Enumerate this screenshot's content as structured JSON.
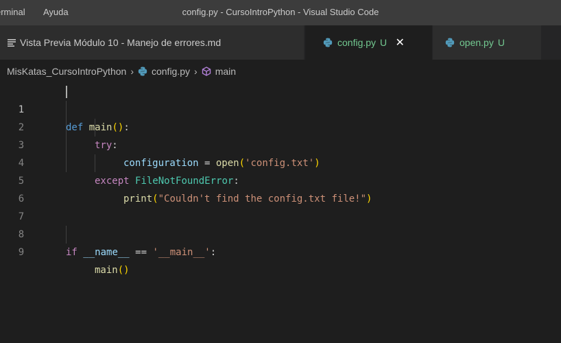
{
  "titlebar": {
    "menu": [
      "erminal",
      "Ayuda"
    ],
    "title": "config.py - CursoIntroPython - Visual Studio Code"
  },
  "tabs": [
    {
      "label": "Vista Previa Módulo 10 - Manejo de errores.md",
      "icon": "preview-icon",
      "status": "",
      "active": false
    },
    {
      "label": "config.py",
      "icon": "python-icon",
      "status": "U",
      "active": true,
      "close": "✕"
    },
    {
      "label": "open.py",
      "icon": "python-icon",
      "status": "U",
      "active": false
    }
  ],
  "breadcrumb": {
    "folder": "MisKatas_CursoIntroPython",
    "file": "config.py",
    "symbol": "main",
    "separator": "›"
  },
  "editor": {
    "active_line": 1,
    "line_numbers": [
      "1",
      "2",
      "3",
      "4",
      "5",
      "6",
      "7",
      "8",
      "9"
    ],
    "code": {
      "l1_def": "def",
      "l1_name": "main",
      "l1_paren": "()",
      "l1_colon": ":",
      "l2_try": "try",
      "l2_colon": ":",
      "l3_var": "configuration",
      "l3_eq": " = ",
      "l3_fn": "open",
      "l3_open": "(",
      "l3_str": "'config.txt'",
      "l3_close": ")",
      "l4_except": "except",
      "l4_cls": "FileNotFoundError",
      "l4_colon": ":",
      "l5_fn": "print",
      "l5_open": "(",
      "l5_str": "\"Couldn't find the config.txt file!\"",
      "l5_close": ")",
      "l8_if": "if",
      "l8_name": "__name__",
      "l8_eq": " == ",
      "l8_str": "'__main__'",
      "l8_colon": ":",
      "l9_fn": "main",
      "l9_paren": "()"
    }
  },
  "colors": {
    "accent_untracked": "#73c991",
    "python_icon": "#519aba",
    "keyword": "#569cd6",
    "control": "#c586c0",
    "function": "#dcdcaa",
    "string": "#ce9178",
    "variable": "#9cdcfe",
    "class": "#4ec9b0",
    "bracket": "#ffd700"
  }
}
